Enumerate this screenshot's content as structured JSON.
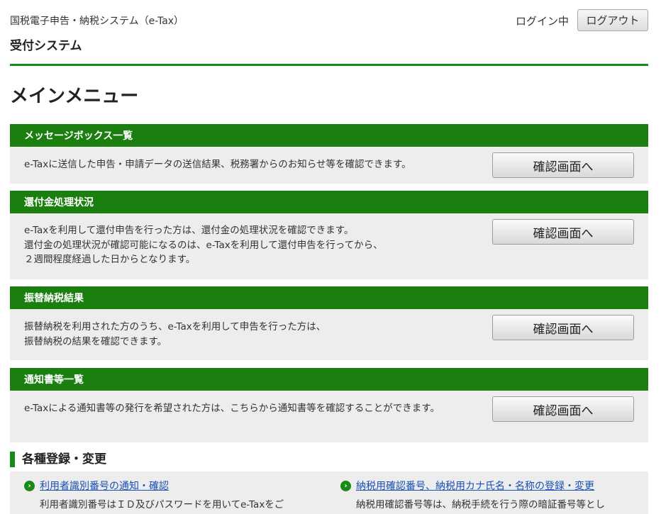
{
  "header": {
    "system_name": "国税電子申告・納税システム（e-Tax）",
    "subsystem": "受付システム",
    "login_status": "ログイン中",
    "logout_label": "ログアウト"
  },
  "page": {
    "title": "メインメニュー"
  },
  "sections": [
    {
      "title": "メッセージボックス一覧",
      "description": "e-Taxに送信した申告・申請データの送信結果、税務署からのお知らせ等を確認できます。",
      "button": "確認画面へ"
    },
    {
      "title": "還付金処理状況",
      "description": "e-Taxを利用して還付申告を行った方は、還付金の処理状況を確認できます。\n還付金の処理状況が確認可能になるのは、e-Taxを利用して還付申告を行ってから、\n２週間程度経過した日からとなります。",
      "button": "確認画面へ"
    },
    {
      "title": "振替納税結果",
      "description": "振替納税を利用された方のうち、e-Taxを利用して申告を行った方は、\n振替納税の結果を確認できます。",
      "button": "確認画面へ"
    },
    {
      "title": "通知書等一覧",
      "description": "e-Taxによる通知書等の発行を希望された方は、こちらから通知書等を確認することができます。",
      "button": "確認画面へ"
    }
  ],
  "registration": {
    "title": "各種登録・変更",
    "items": [
      {
        "link": "利用者識別番号の通知・確認",
        "description": "利用者識別番号はＩＤ及びパスワードを用いてe-Taxをご"
      },
      {
        "link": "納税用確認番号、納税用カナ氏名・名称の登録・変更",
        "description": "納税用確認番号等は、納税手続を行う際の暗証番号等とし"
      }
    ]
  },
  "colors": {
    "accent_green": "#1a7f0f",
    "link_blue": "#1a4fb5",
    "panel_gray": "#ededed"
  }
}
